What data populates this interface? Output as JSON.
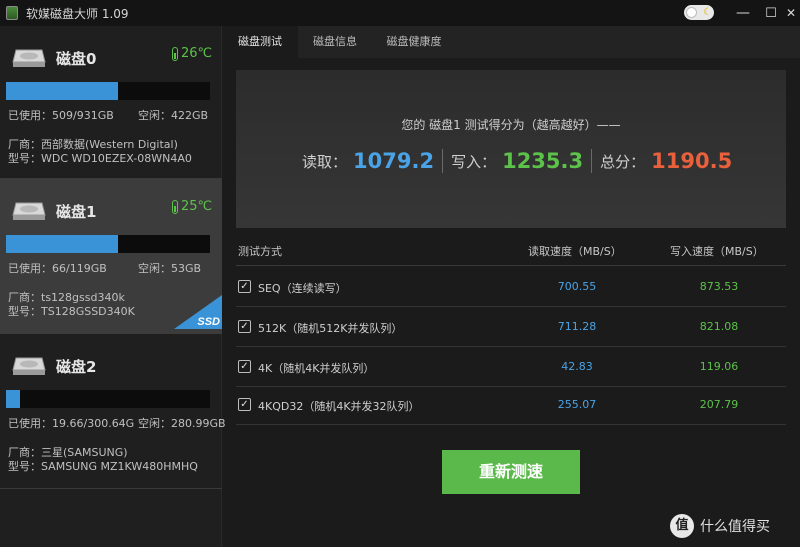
{
  "window": {
    "title": "软媒磁盘大师 1.09",
    "minimize_glyph": "—",
    "maximize_glyph": "☐",
    "close_glyph": "✕"
  },
  "theme_toggle": {
    "icon": "moon-icon"
  },
  "disks": [
    {
      "name": "磁盘0",
      "temp": "26℃",
      "usage_fraction": 0.55,
      "used": "已使用：509/931GB",
      "free": "空闲：422GB",
      "vendor": "厂商：西部数据(Western Digital)",
      "model": "型号：WDC WD10EZEX-08WN4A0",
      "selected": false
    },
    {
      "name": "磁盘1",
      "temp": "25℃",
      "usage_fraction": 0.55,
      "used": "已使用：66/119GB",
      "free": "空闲：53GB",
      "vendor": "厂商：ts128gssd340k",
      "model": "型号：TS128GSSD340K",
      "selected": true,
      "badge": "SSD"
    },
    {
      "name": "磁盘2",
      "temp": "",
      "usage_fraction": 0.07,
      "used": "已使用：19.66/300.64G",
      "free": "空闲：280.99GB",
      "vendor": "厂商：三星(SAMSUNG)",
      "model": "型号：SAMSUNG MZ1KW480HMHQ",
      "selected": false
    }
  ],
  "tabs": [
    {
      "label": "磁盘测试",
      "active": true
    },
    {
      "label": "磁盘信息",
      "active": false
    },
    {
      "label": "磁盘健康度",
      "active": false
    }
  ],
  "score": {
    "summary": "您的 磁盘1 测试得分为（越高越好）——",
    "read_label": "读取：",
    "read_value": "1079.2",
    "write_label": "写入：",
    "write_value": "1235.3",
    "total_label": "总分：",
    "total_value": "1190.5",
    "colors": {
      "read": "#4aa3e6",
      "write": "#5cc24a",
      "total": "#e8603c"
    }
  },
  "table": {
    "headers": {
      "method": "测试方式",
      "read": "读取速度（MB/S）",
      "write": "写入速度（MB/S）"
    },
    "rows": [
      {
        "name": "SEQ（连续读写）",
        "read": "700.55",
        "write": "873.53",
        "checked": true
      },
      {
        "name": "512K（随机512K并发队列）",
        "read": "711.28",
        "write": "821.08",
        "checked": true
      },
      {
        "name": "4K（随机4K并发队列）",
        "read": "42.83",
        "write": "119.06",
        "checked": true
      },
      {
        "name": "4KQD32（随机4K并发32队列）",
        "read": "255.07",
        "write": "207.79",
        "checked": true
      }
    ]
  },
  "retest_button": "重新测速",
  "watermark": {
    "logo": "值",
    "text": "什么值得买"
  }
}
